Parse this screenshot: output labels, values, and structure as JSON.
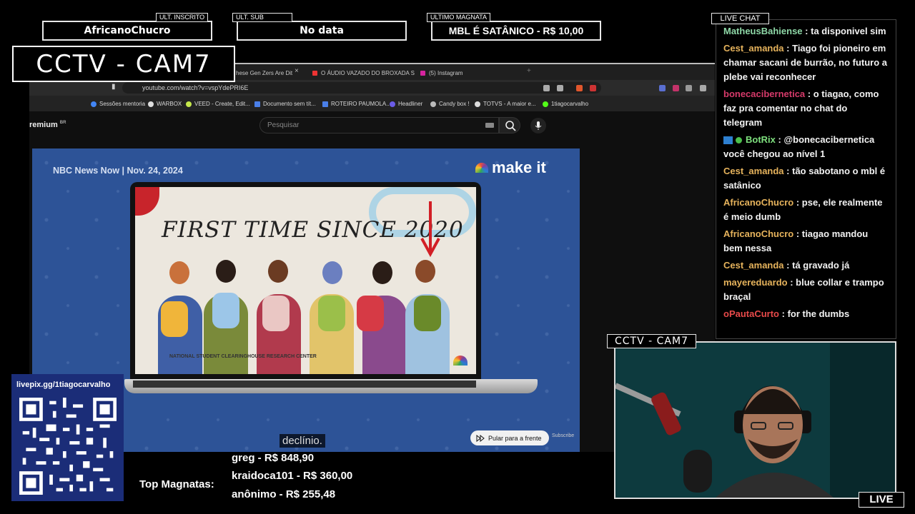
{
  "overlay": {
    "ult_inscrito": {
      "tag": "ULT. INSCRITO",
      "value": "AfricanoChucro"
    },
    "ult_sub": {
      "tag": "ULT. SUB",
      "value": "No data"
    },
    "ultimo_magnata": {
      "tag": "ULTIMO MAGNATA",
      "value": "MBL É SATÂNICO - R$ 10,00"
    },
    "cctv_main": "CCTV - CAM7",
    "cctv_cam": "CCTV - CAM7",
    "live_chat_tag": "LIVE CHAT",
    "live_badge": "LIVE"
  },
  "browser": {
    "tabs": [
      {
        "label": "hese Gen Zers Are Dit"
      },
      {
        "label": "O ÁUDIO VAZADO DO BROXADA S"
      },
      {
        "label": "(5) Instagram"
      }
    ],
    "url": "youtube.com/watch?v=vspYdePRI6E",
    "bookmarks": [
      "Sessões mentoria",
      "WARBOX",
      "VEED - Create, Edit...",
      "Documento sem tít...",
      "ROTEIRO PAUMOLA...",
      "Headliner",
      "Candy box !",
      "TOTVS - A maior e...",
      "1tiagocarvalho"
    ]
  },
  "youtube": {
    "logo": "remium",
    "logo_sup": "BR",
    "search_placeholder": "Pesquisar"
  },
  "video": {
    "source": "NBC News Now | Nov. 24, 2024",
    "brand": "make it",
    "headline": "FIRST TIME SINCE 2020",
    "credit": "NATIONAL STUDENT CLEARINGHOUSE RESEARCH CENTER",
    "subtitle": "declínio.",
    "skip_label": "Pular para a frente",
    "subscribe": "Subscribe"
  },
  "chat": {
    "messages": [
      {
        "user": "MatheusBahiense",
        "text": "ta disponivel sim",
        "color": "#8fd9a8"
      },
      {
        "user": "Cest_amanda",
        "text": "Tiago foi pioneiro em chamar sacani de burrão, no futuro a plebe vai reconhecer",
        "color": "#e6b35c"
      },
      {
        "user": "bonecacibernetica",
        "text": "o tiagao, como faz pra comentar no chat do telegram",
        "color": "#d63a6a"
      },
      {
        "user": "BotRix",
        "text": "@bonecacibernetica você chegou ao nível 1",
        "color": "#7ee07e"
      },
      {
        "user": "Cest_amanda",
        "text": "tão sabotano o mbl é satânico",
        "color": "#e6b35c"
      },
      {
        "user": "AfricanoChucro",
        "text": "pse, ele realmente é meio dumb",
        "color": "#e6b35c"
      },
      {
        "user": "AfricanoChucro",
        "text": "tiagao mandou bem nessa",
        "color": "#e6b35c"
      },
      {
        "user": "Cest_amanda",
        "text": "tá gravado já",
        "color": "#e6b35c"
      },
      {
        "user": "mayereduardo",
        "text": "blue collar e trampo braçal",
        "color": "#e6b35c"
      },
      {
        "user": "oPautaCurto",
        "text": "for the dumbs",
        "color": "#e84a4a"
      }
    ]
  },
  "qr": {
    "url": "livepix.gg/1tiagocarvalho"
  },
  "magnatas": {
    "label": "Top Magnatas:",
    "items": [
      "greg - R$ 848,90",
      "kraidoca101 - R$ 360,00",
      "anônimo - R$ 255,48"
    ]
  }
}
